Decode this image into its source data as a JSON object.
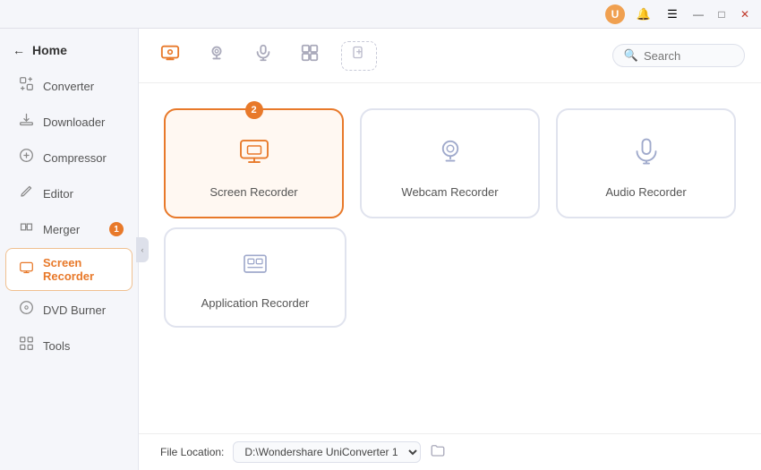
{
  "titlebar": {
    "avatar_label": "U",
    "bell_icon": "🔔",
    "menu_icon": "☰",
    "minimize_icon": "—",
    "maximize_icon": "□",
    "close_icon": "✕"
  },
  "sidebar": {
    "home_label": "Home",
    "items": [
      {
        "id": "converter",
        "label": "Converter",
        "icon": "converter"
      },
      {
        "id": "downloader",
        "label": "Downloader",
        "icon": "downloader"
      },
      {
        "id": "compressor",
        "label": "Compressor",
        "icon": "compressor"
      },
      {
        "id": "editor",
        "label": "Editor",
        "icon": "editor"
      },
      {
        "id": "merger",
        "label": "Merger",
        "icon": "merger",
        "badge": "1"
      },
      {
        "id": "screen-recorder",
        "label": "Screen Recorder",
        "icon": "screen-recorder",
        "active": true
      },
      {
        "id": "dvd-burner",
        "label": "DVD Burner",
        "icon": "dvd"
      },
      {
        "id": "tools",
        "label": "Tools",
        "icon": "tools"
      }
    ]
  },
  "toolbar": {
    "search_placeholder": "Search",
    "icons": [
      "screen",
      "webcam",
      "mic",
      "grid"
    ]
  },
  "recorders": [
    {
      "id": "screen",
      "label": "Screen Recorder",
      "active": true,
      "badge": "2"
    },
    {
      "id": "webcam",
      "label": "Webcam Recorder",
      "active": false
    },
    {
      "id": "audio",
      "label": "Audio Recorder",
      "active": false
    },
    {
      "id": "app",
      "label": "Application Recorder",
      "active": false,
      "row2": true
    }
  ],
  "footer": {
    "file_location_label": "File Location:",
    "file_location_value": "D:\\Wondershare UniConverter 1",
    "folder_icon": "📁"
  }
}
